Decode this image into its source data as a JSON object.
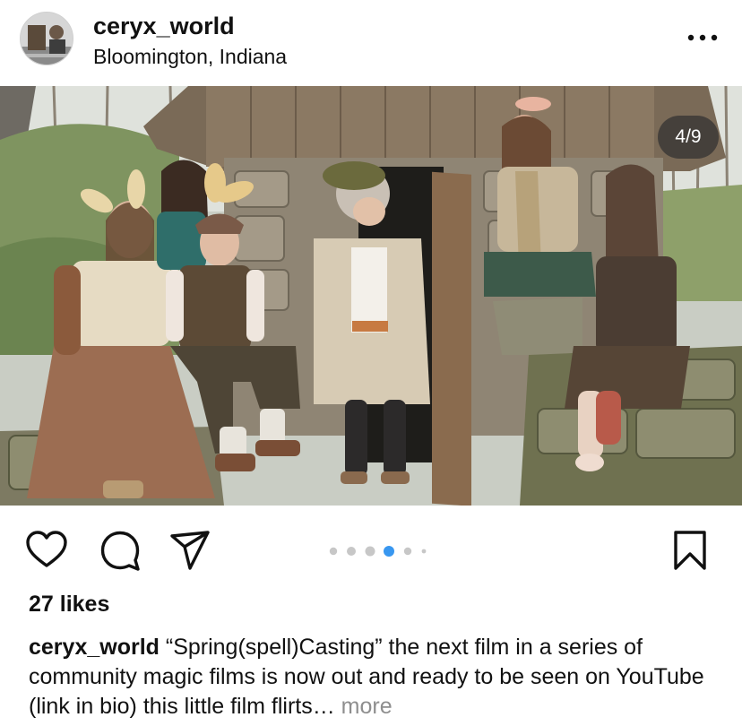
{
  "header": {
    "username": "ceryx_world",
    "location": "Bloomington, Indiana",
    "avatar_icon": "profile-avatar",
    "more_icon": "ellipsis-icon"
  },
  "post": {
    "page_indicator": "4/9",
    "carousel": {
      "total": 6,
      "active_index": 3
    }
  },
  "actions": {
    "like_icon": "heart-icon",
    "comment_icon": "comment-icon",
    "share_icon": "paper-plane-icon",
    "save_icon": "bookmark-icon",
    "active_dot_color": "#3897f0",
    "inactive_dot_color": "#c7c7c7"
  },
  "likes": "27 likes",
  "caption": {
    "username": "ceryx_world",
    "text": " “Spring(spell)Casting” the next film in a series of community magic films is now out and ready to be seen on YouTube (link in bio) this little film flirts…",
    "more": " more"
  }
}
